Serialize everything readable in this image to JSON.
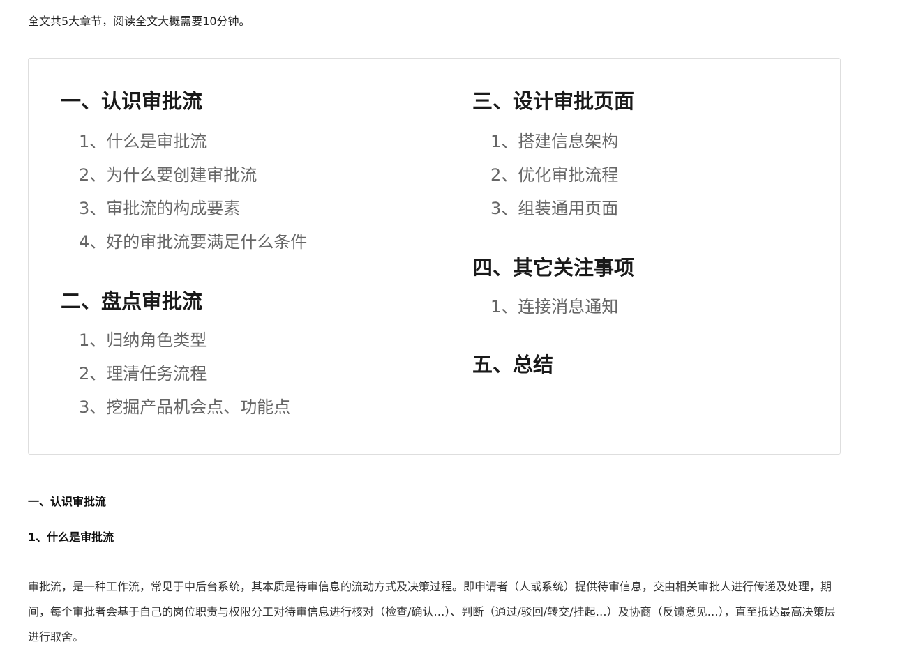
{
  "intro": "全文共5大章节，阅读全文大概需要10分钟。",
  "toc": {
    "left": [
      {
        "title": "一、认识审批流",
        "items": [
          "1、什么是审批流",
          "2、为什么要创建审批流",
          "3、审批流的构成要素",
          "4、好的审批流要满足什么条件"
        ]
      },
      {
        "title": "二、盘点审批流",
        "items": [
          "1、归纳角色类型",
          "2、理清任务流程",
          "3、挖掘产品机会点、功能点"
        ]
      }
    ],
    "right": [
      {
        "title": "三、设计审批页面",
        "items": [
          "1、搭建信息架构",
          "2、优化审批流程",
          "3、组装通用页面"
        ]
      },
      {
        "title": "四、其它关注事项",
        "items": [
          "1、连接消息通知"
        ]
      },
      {
        "title": "五、总结",
        "items": []
      }
    ]
  },
  "article": {
    "section_title": "一、认识审批流",
    "subsection_title": "1、什么是审批流",
    "paragraph": "审批流，是一种工作流，常见于中后台系统，其本质是待审信息的流动方式及决策过程。即申请者（人或系统）提供待审信息，交由相关审批人进行传递及处理，期间，每个审批者会基于自己的岗位职责与权限分工对待审信息进行核对（检查/确认…）、判断（通过/驳回/转交/挂起…）及协商（反馈意见…），直至抵达最高决策层进行取舍。"
  }
}
